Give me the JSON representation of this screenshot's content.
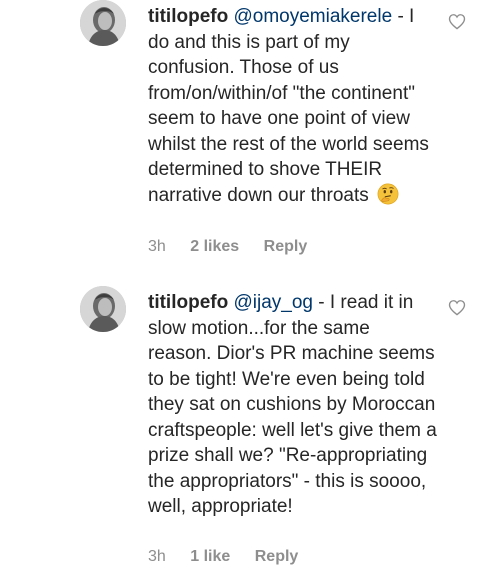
{
  "comments": [
    {
      "username": "titilopefo",
      "mention": "@omoyemiakerele",
      "text": " - I do and this is part of my confusion. Those of us from/on/within/of \"the continent\" seem to have one point of view whilst the rest of the world seems determined to shove THEIR narrative down our throats",
      "emoji": "thinking-face-emoji",
      "time": "3h",
      "likes": "2 likes",
      "reply": "Reply"
    },
    {
      "username": "titilopefo",
      "mention": "@ijay_og",
      "text": " - I read it in slow motion...for the same reason. Dior's PR machine seems to be tight! We're even being told they sat on cushions by Moroccan craftspeople: well let's give them a prize shall we? \"Re-appropriating the appropriators\" - this is soooo, well, appropriate!",
      "time": "3h",
      "likes": "1 like",
      "reply": "Reply"
    }
  ],
  "colors": {
    "text": "#262626",
    "mention": "#00376b",
    "meta": "#8e8e8e"
  }
}
